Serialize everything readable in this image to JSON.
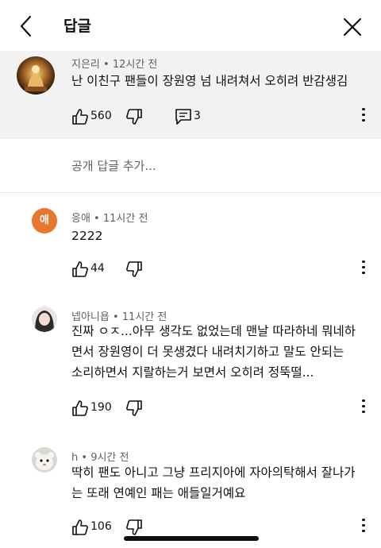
{
  "header": {
    "title": "답글"
  },
  "main_comment": {
    "author": "지은리",
    "time": "12시간 전",
    "text": "난 이친구 팬들이 장원영 넘 내려쳐서 오히려 반감생김",
    "likes": "560",
    "replies": "3"
  },
  "add_reply": {
    "placeholder": "공개 답글 추가..."
  },
  "replies": [
    {
      "author": "응애",
      "avatar_letter": "애",
      "avatar_color": "#e8772e",
      "time": "11시간 전",
      "lines": [
        "2222"
      ],
      "likes": "44"
    },
    {
      "author": "넵아니욥",
      "time": "11시간 전",
      "lines": [
        "진짜 ㅇㅈ...아무 생각도 없었는데 맨날 따라하네 뭐네하",
        "면서 장원영이 더 못생겼다 내려치기하고 말도 안되는",
        "소리하면서 지랄하는거 보면서 오히려 정뚝떨..."
      ],
      "likes": "190"
    },
    {
      "author": "h",
      "time": "9시간 전",
      "lines": [
        "딱히 팬도 아니고 그냥 프리지아에 자아의탁해서 잘나가",
        "는 또래 연예인 패는 애들일거예요"
      ],
      "likes": "106"
    }
  ],
  "icons": [
    "back-arrow-icon",
    "close-icon",
    "like-icon",
    "dislike-icon",
    "reply-icon",
    "more-icon"
  ]
}
